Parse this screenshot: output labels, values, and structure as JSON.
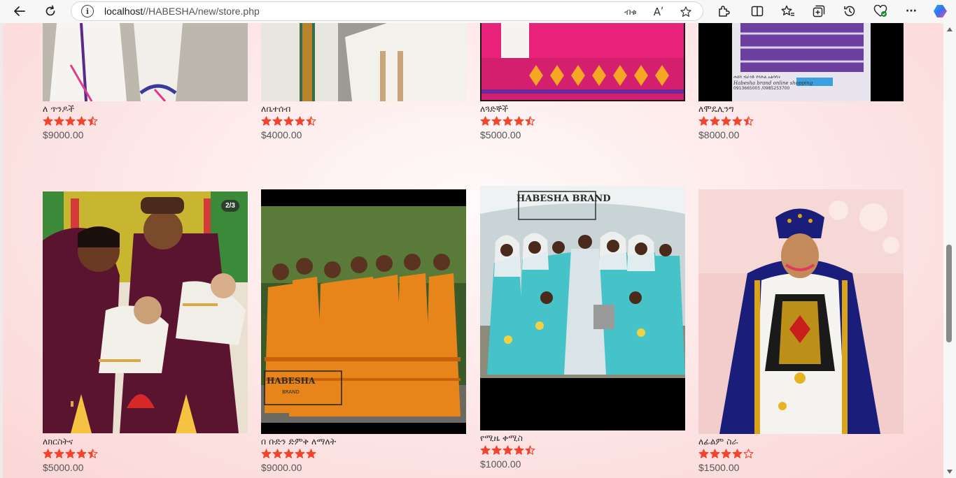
{
  "browser": {
    "url_host": "localhost",
    "url_path": "//HABESHA/new/store.php",
    "icons": [
      "back-arrow-icon",
      "refresh-icon",
      "info-icon",
      "translate-icon",
      "read-aloud-icon",
      "favorite-star-icon",
      "extensions-icon",
      "split-screen-icon",
      "favorites-icon",
      "collections-icon",
      "history-icon",
      "performance-icon",
      "more-icon",
      "copilot-icon"
    ],
    "translate_label": "ብቁ",
    "read_aloud_label": "Aʹ",
    "more_label": "···"
  },
  "colors": {
    "star": "#f2442c",
    "price": "#555555",
    "background": "#fde6e6"
  },
  "products": [
    {
      "name": "ለ ጥንዶች",
      "rating": 4.5,
      "price": "$9000.00",
      "photo": "white-dress-photo"
    },
    {
      "name": "ለቤተሰብ",
      "rating": 4.5,
      "price": "$4000.00",
      "photo": "family-white-photo"
    },
    {
      "name": "ለጓድኞች",
      "rating": 4.5,
      "price": "$5000.00",
      "photo": "pink-dress-photo"
    },
    {
      "name": "ለሞዴሊንግ",
      "rating": 4.5,
      "price": "$8000.00",
      "photo": "purple-dress-photo",
      "caption": "Habesha brand online shopping",
      "caption_sub": "0913665005 /0985253700",
      "caption_am": "ሐበሻ ብራንድ የባሕል አልባሳት"
    },
    {
      "name": "ለክርስትና",
      "rating": 4.5,
      "price": "$5000.00",
      "photo": "christening-family-photo",
      "badge": "2/3"
    },
    {
      "name": "በ ቡድን ድምቅ ለማለት",
      "rating": 5,
      "price": "$9000.00",
      "photo": "orange-group-photo"
    },
    {
      "name": "የሚዜ ቀሚስ",
      "rating": 4.5,
      "price": "$1000.00",
      "photo": "bridesmaid-photo",
      "watermark": "HABESHA BRAND"
    },
    {
      "name": "ለፊልም ስራ",
      "rating": 4,
      "price": "$1500.00",
      "photo": "blue-cape-photo"
    }
  ]
}
